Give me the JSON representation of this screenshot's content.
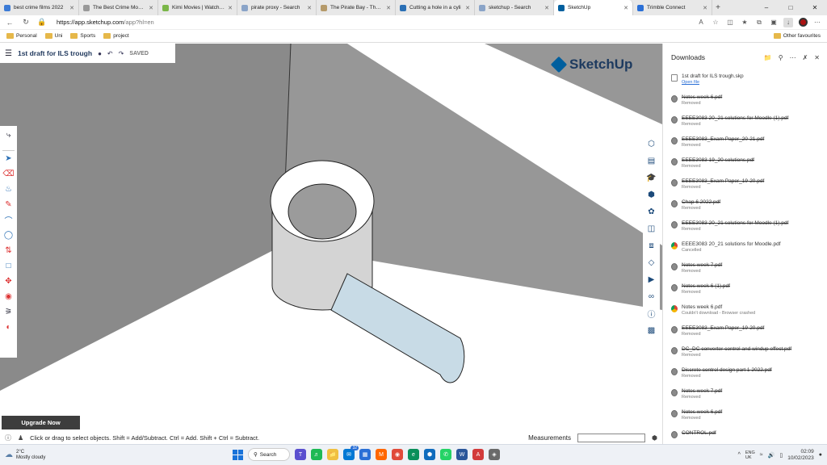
{
  "browser": {
    "tabs": [
      {
        "label": "best crime films 2022",
        "color": "#3c7bd6"
      },
      {
        "label": "The Best Crime Movies",
        "color": "#999999"
      },
      {
        "label": "Kimi Movies | Watch M",
        "color": "#7ab648"
      },
      {
        "label": "pirate proxy - Search",
        "color": "#8aa4c8"
      },
      {
        "label": "The Pirate Bay - The g",
        "color": "#b59a6a"
      },
      {
        "label": "Cutting a hole in a cyli",
        "color": "#2a6fb5"
      },
      {
        "label": "sketchup - Search",
        "color": "#8aa4c8"
      },
      {
        "label": "SketchUp",
        "color": "#005f9e"
      },
      {
        "label": "Trimble Connect",
        "color": "#2a6fd6"
      }
    ],
    "url": {
      "host": "https://app.sketchup.com",
      "path": "/app?hl=en"
    },
    "bookmarks": [
      "Personal",
      "Uni",
      "Sports",
      "project"
    ],
    "other_favourites": "Other favourites"
  },
  "app": {
    "doc_title": "1st draft for ILS trough",
    "saved_label": "SAVED",
    "logo": "SketchUp",
    "upgrade_label": "Upgrade Now",
    "status_hint": "Click or drag to select objects. Shift = Add/Subtract. Ctrl = Add. Shift + Ctrl = Subtract.",
    "measurements_label": "Measurements"
  },
  "downloads": {
    "title": "Downloads",
    "items": [
      {
        "name": "1st draft for ILS trough.skp",
        "status": "Open file",
        "strike": false,
        "icon": "file"
      },
      {
        "name": "Notes week 6.pdf",
        "status": "Removed",
        "strike": true,
        "icon": "circle"
      },
      {
        "name": "EEEE3083 20_21 solutions for Moodle (1).pdf",
        "status": "Removed",
        "strike": true,
        "icon": "circle"
      },
      {
        "name": "EEEE3083_Exam Paper_20-21.pdf",
        "status": "Removed",
        "strike": true,
        "icon": "circle"
      },
      {
        "name": "EEEE3083 19_20 solutions.pdf",
        "status": "Removed",
        "strike": true,
        "icon": "circle"
      },
      {
        "name": "EEEE3083_Exam Paper_19-20.pdf",
        "status": "Removed",
        "strike": true,
        "icon": "circle"
      },
      {
        "name": "Chap 6 2022.pdf",
        "status": "Removed",
        "strike": true,
        "icon": "circle"
      },
      {
        "name": "EEEE3083 20_21 solutions for Moodle (1).pdf",
        "status": "Removed",
        "strike": true,
        "icon": "circle"
      },
      {
        "name": "EEEE3083 20_21 solutions for Moodle.pdf",
        "status": "Cancelled",
        "strike": false,
        "icon": "chrome"
      },
      {
        "name": "Notes week 7.pdf",
        "status": "Removed",
        "strike": true,
        "icon": "circle"
      },
      {
        "name": "Notes week 6 (1).pdf",
        "status": "Removed",
        "strike": true,
        "icon": "circle"
      },
      {
        "name": "Notes week 6.pdf",
        "status": "Couldn't download - Browser crashed",
        "strike": false,
        "icon": "chrome"
      },
      {
        "name": "EEEE3083_Exam Paper_19-20.pdf",
        "status": "Removed",
        "strike": true,
        "icon": "circle"
      },
      {
        "name": "DC_DC converter control and windup effect.pdf",
        "status": "Removed",
        "strike": true,
        "icon": "circle"
      },
      {
        "name": "Discrete control design part 1 2022.pdf",
        "status": "Removed",
        "strike": true,
        "icon": "circle"
      },
      {
        "name": "Notes week 7.pdf",
        "status": "Removed",
        "strike": true,
        "icon": "circle"
      },
      {
        "name": "Notes week 6.pdf",
        "status": "Removed",
        "strike": true,
        "icon": "circle"
      },
      {
        "name": "CONTROL.pdf",
        "status": "",
        "strike": true,
        "icon": "circle"
      }
    ]
  },
  "taskbar": {
    "temp": "2°C",
    "weather": "Mostly cloudy",
    "search_label": "Search",
    "badge": "32",
    "language": "ENG\nUK",
    "time": "02:09",
    "date": "10/02/2023"
  }
}
